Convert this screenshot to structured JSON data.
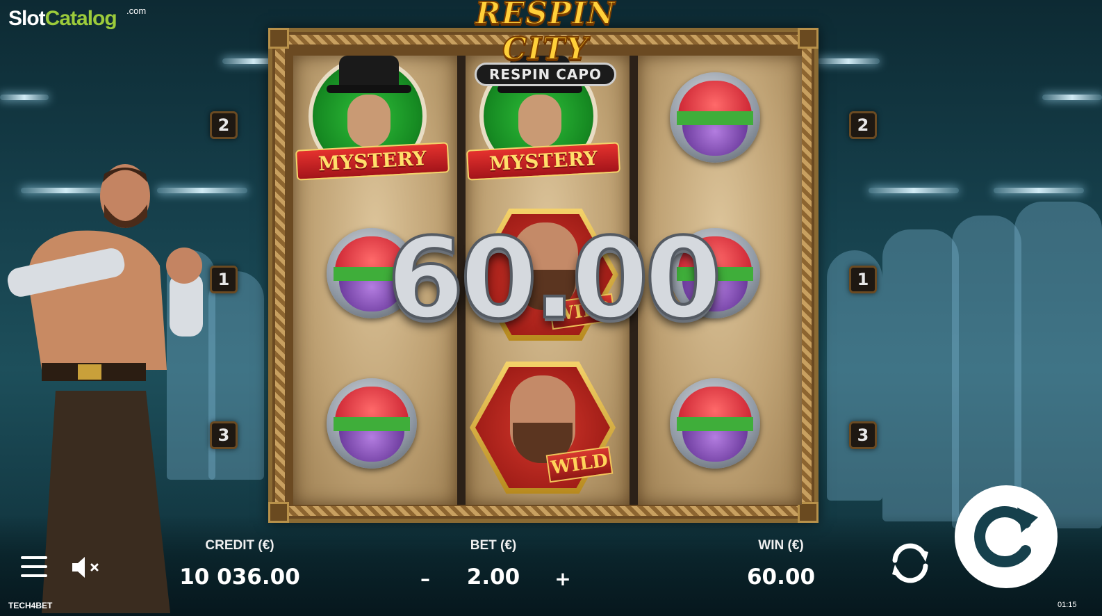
{
  "logo": {
    "primary": "Slot",
    "secondary": "Catalog",
    "suffix": ".com"
  },
  "game_title": {
    "line1": "RESPIN CITY",
    "line2": "RESPIN CAPO"
  },
  "reels": {
    "symbols": [
      [
        "mystery",
        "gem",
        "gem"
      ],
      [
        "mystery",
        "wild",
        "wild"
      ],
      [
        "gem",
        "gem",
        "gem"
      ]
    ],
    "mystery_label": "MYSTERY",
    "wild_label": "WILD"
  },
  "win_overlay": "60.00",
  "paylines": {
    "left": [
      "2",
      "1",
      "3"
    ],
    "right": [
      "2",
      "1",
      "3"
    ]
  },
  "panel": {
    "credit_label": "CREDIT (€)",
    "credit_value": "10 036.00",
    "bet_label": "BET (€)",
    "bet_value": "2.00",
    "bet_minus": "–",
    "bet_plus": "+",
    "win_label": "WIN (€)",
    "win_value": "60.00"
  },
  "footer": {
    "brand": "TECH4BET",
    "clock": "01:15"
  },
  "colors": {
    "accent_green": "#9ccb3b",
    "gold": "#ffd03a",
    "background": "#16404c"
  },
  "icons": [
    "menu-icon",
    "sound-muted-icon",
    "autoplay-icon",
    "spin-icon"
  ]
}
